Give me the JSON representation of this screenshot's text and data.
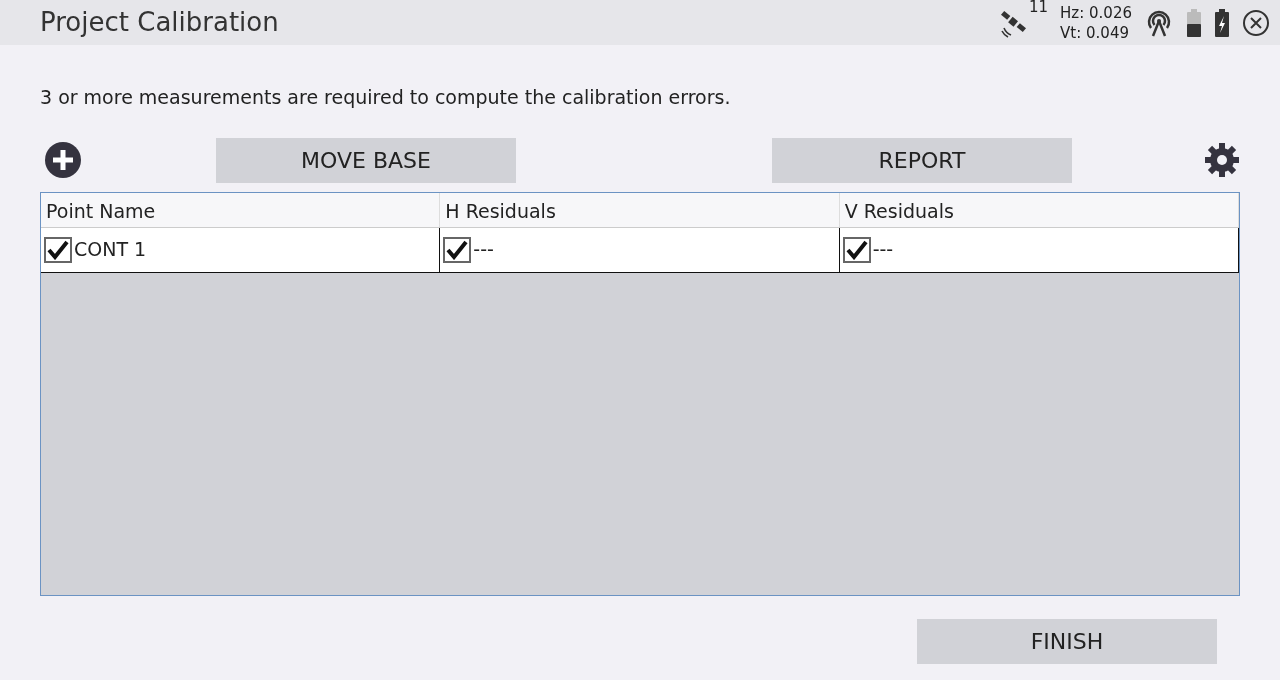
{
  "window": {
    "title": "Project Calibration"
  },
  "status": {
    "satellites": "11",
    "hz": "Hz: 0.026",
    "vt": "Vt: 0.049"
  },
  "message": "3 or more measurements are required to compute the calibration errors.",
  "toolbar": {
    "buttons": [
      "MOVE BASE",
      "REPORT"
    ]
  },
  "table": {
    "columns": [
      "Point Name",
      "H Residuals",
      "V Residuals"
    ],
    "rows": [
      {
        "cells": [
          {
            "checked": true,
            "text": "CONT 1"
          },
          {
            "checked": true,
            "text": "---"
          },
          {
            "checked": true,
            "text": "---"
          }
        ]
      }
    ]
  },
  "footer": {
    "button": "FINISH"
  }
}
